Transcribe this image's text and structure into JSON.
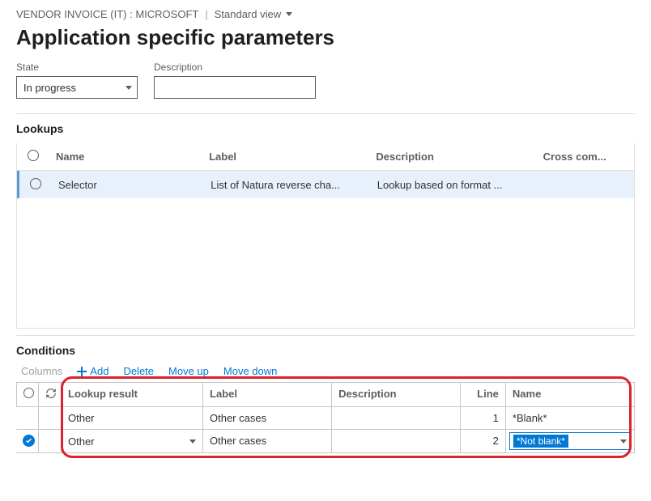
{
  "breadcrumb": {
    "context": "VENDOR INVOICE (IT) : MICROSOFT",
    "view_label": "Standard view"
  },
  "page_title": "Application specific parameters",
  "state_field": {
    "label": "State",
    "value": "In progress"
  },
  "description_field": {
    "label": "Description",
    "value": ""
  },
  "lookups": {
    "title": "Lookups",
    "cols": {
      "name": "Name",
      "label": "Label",
      "description": "Description",
      "cross": "Cross com..."
    },
    "rows": [
      {
        "name": "Selector",
        "label": "List of Natura reverse cha...",
        "description": "Lookup based on format ...",
        "cross": ""
      }
    ]
  },
  "conditions": {
    "title": "Conditions",
    "toolbar": {
      "columns": "Columns",
      "add": "Add",
      "delete": "Delete",
      "moveup": "Move up",
      "movedown": "Move down"
    },
    "cols": {
      "lookup_result": "Lookup result",
      "label": "Label",
      "description": "Description",
      "line": "Line",
      "name": "Name"
    },
    "rows": [
      {
        "lookup_result": "Other",
        "label": "Other cases",
        "description": "",
        "line": "1",
        "name": "*Blank*"
      },
      {
        "lookup_result": "Other",
        "label": "Other cases",
        "description": "",
        "line": "2",
        "name": "*Not blank*"
      }
    ]
  }
}
